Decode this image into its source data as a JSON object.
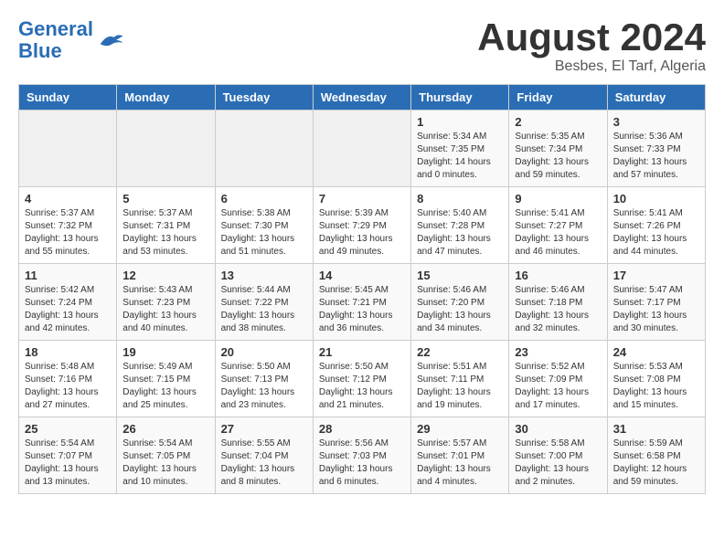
{
  "header": {
    "logo_line1": "General",
    "logo_line2": "Blue",
    "title": "August 2024",
    "subtitle": "Besbes, El Tarf, Algeria"
  },
  "days_of_week": [
    "Sunday",
    "Monday",
    "Tuesday",
    "Wednesday",
    "Thursday",
    "Friday",
    "Saturday"
  ],
  "weeks": [
    [
      {
        "day": "",
        "info": ""
      },
      {
        "day": "",
        "info": ""
      },
      {
        "day": "",
        "info": ""
      },
      {
        "day": "",
        "info": ""
      },
      {
        "day": "1",
        "info": "Sunrise: 5:34 AM\nSunset: 7:35 PM\nDaylight: 14 hours\nand 0 minutes."
      },
      {
        "day": "2",
        "info": "Sunrise: 5:35 AM\nSunset: 7:34 PM\nDaylight: 13 hours\nand 59 minutes."
      },
      {
        "day": "3",
        "info": "Sunrise: 5:36 AM\nSunset: 7:33 PM\nDaylight: 13 hours\nand 57 minutes."
      }
    ],
    [
      {
        "day": "4",
        "info": "Sunrise: 5:37 AM\nSunset: 7:32 PM\nDaylight: 13 hours\nand 55 minutes."
      },
      {
        "day": "5",
        "info": "Sunrise: 5:37 AM\nSunset: 7:31 PM\nDaylight: 13 hours\nand 53 minutes."
      },
      {
        "day": "6",
        "info": "Sunrise: 5:38 AM\nSunset: 7:30 PM\nDaylight: 13 hours\nand 51 minutes."
      },
      {
        "day": "7",
        "info": "Sunrise: 5:39 AM\nSunset: 7:29 PM\nDaylight: 13 hours\nand 49 minutes."
      },
      {
        "day": "8",
        "info": "Sunrise: 5:40 AM\nSunset: 7:28 PM\nDaylight: 13 hours\nand 47 minutes."
      },
      {
        "day": "9",
        "info": "Sunrise: 5:41 AM\nSunset: 7:27 PM\nDaylight: 13 hours\nand 46 minutes."
      },
      {
        "day": "10",
        "info": "Sunrise: 5:41 AM\nSunset: 7:26 PM\nDaylight: 13 hours\nand 44 minutes."
      }
    ],
    [
      {
        "day": "11",
        "info": "Sunrise: 5:42 AM\nSunset: 7:24 PM\nDaylight: 13 hours\nand 42 minutes."
      },
      {
        "day": "12",
        "info": "Sunrise: 5:43 AM\nSunset: 7:23 PM\nDaylight: 13 hours\nand 40 minutes."
      },
      {
        "day": "13",
        "info": "Sunrise: 5:44 AM\nSunset: 7:22 PM\nDaylight: 13 hours\nand 38 minutes."
      },
      {
        "day": "14",
        "info": "Sunrise: 5:45 AM\nSunset: 7:21 PM\nDaylight: 13 hours\nand 36 minutes."
      },
      {
        "day": "15",
        "info": "Sunrise: 5:46 AM\nSunset: 7:20 PM\nDaylight: 13 hours\nand 34 minutes."
      },
      {
        "day": "16",
        "info": "Sunrise: 5:46 AM\nSunset: 7:18 PM\nDaylight: 13 hours\nand 32 minutes."
      },
      {
        "day": "17",
        "info": "Sunrise: 5:47 AM\nSunset: 7:17 PM\nDaylight: 13 hours\nand 30 minutes."
      }
    ],
    [
      {
        "day": "18",
        "info": "Sunrise: 5:48 AM\nSunset: 7:16 PM\nDaylight: 13 hours\nand 27 minutes."
      },
      {
        "day": "19",
        "info": "Sunrise: 5:49 AM\nSunset: 7:15 PM\nDaylight: 13 hours\nand 25 minutes."
      },
      {
        "day": "20",
        "info": "Sunrise: 5:50 AM\nSunset: 7:13 PM\nDaylight: 13 hours\nand 23 minutes."
      },
      {
        "day": "21",
        "info": "Sunrise: 5:50 AM\nSunset: 7:12 PM\nDaylight: 13 hours\nand 21 minutes."
      },
      {
        "day": "22",
        "info": "Sunrise: 5:51 AM\nSunset: 7:11 PM\nDaylight: 13 hours\nand 19 minutes."
      },
      {
        "day": "23",
        "info": "Sunrise: 5:52 AM\nSunset: 7:09 PM\nDaylight: 13 hours\nand 17 minutes."
      },
      {
        "day": "24",
        "info": "Sunrise: 5:53 AM\nSunset: 7:08 PM\nDaylight: 13 hours\nand 15 minutes."
      }
    ],
    [
      {
        "day": "25",
        "info": "Sunrise: 5:54 AM\nSunset: 7:07 PM\nDaylight: 13 hours\nand 13 minutes."
      },
      {
        "day": "26",
        "info": "Sunrise: 5:54 AM\nSunset: 7:05 PM\nDaylight: 13 hours\nand 10 minutes."
      },
      {
        "day": "27",
        "info": "Sunrise: 5:55 AM\nSunset: 7:04 PM\nDaylight: 13 hours\nand 8 minutes."
      },
      {
        "day": "28",
        "info": "Sunrise: 5:56 AM\nSunset: 7:03 PM\nDaylight: 13 hours\nand 6 minutes."
      },
      {
        "day": "29",
        "info": "Sunrise: 5:57 AM\nSunset: 7:01 PM\nDaylight: 13 hours\nand 4 minutes."
      },
      {
        "day": "30",
        "info": "Sunrise: 5:58 AM\nSunset: 7:00 PM\nDaylight: 13 hours\nand 2 minutes."
      },
      {
        "day": "31",
        "info": "Sunrise: 5:59 AM\nSunset: 6:58 PM\nDaylight: 12 hours\nand 59 minutes."
      }
    ]
  ]
}
